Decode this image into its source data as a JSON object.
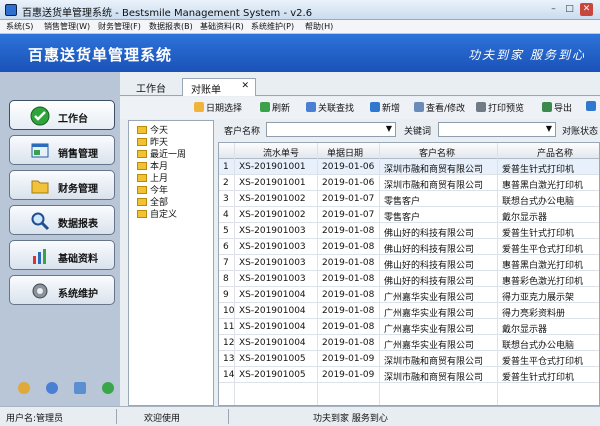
{
  "window": {
    "title": "百惠送货单管理系统 - Bestsmile Management System - v2.6"
  },
  "menu": [
    "系统(S)",
    "销售管理(W)",
    "财务管理(F)",
    "数据报表(B)",
    "基础资料(R)",
    "系统维护(P)",
    "帮助(H)"
  ],
  "banner": {
    "title": "百惠送货单管理系统",
    "slogan": "功夫到家 服务到心"
  },
  "sidebar": {
    "items": [
      {
        "label": "工作台",
        "icon": "check-icon"
      },
      {
        "label": "销售管理",
        "icon": "window-icon"
      },
      {
        "label": "财务管理",
        "icon": "folder-icon"
      },
      {
        "label": "数据报表",
        "icon": "magnifier-icon"
      },
      {
        "label": "基础资料",
        "icon": "chart-icon"
      },
      {
        "label": "系统维护",
        "icon": "gear-icon"
      }
    ]
  },
  "tabs": [
    "工作台",
    "对账单"
  ],
  "toolbar": [
    "日期选择",
    "刷新",
    "关联查找",
    "新增",
    "查看/修改",
    "打印预览",
    "导出"
  ],
  "tree": [
    "今天",
    "昨天",
    "最近一周",
    "本月",
    "上月",
    "今年",
    "全部",
    "自定义"
  ],
  "filter": {
    "customer_label": "客户名称",
    "keyword_label": "关键词",
    "status_label": "对账状态"
  },
  "table": {
    "headers": [
      "流水单号",
      "单据日期",
      "客户名称",
      "产品名称"
    ],
    "rows": [
      [
        "1",
        "XS-201901001",
        "2019-01-06",
        "深圳市融和商贸有限公司",
        "爱普生针式打印机"
      ],
      [
        "2",
        "XS-201901001",
        "2019-01-06",
        "深圳市融和商贸有限公司",
        "惠普黑白激光打印机"
      ],
      [
        "3",
        "XS-201901002",
        "2019-01-07",
        "零售客户",
        "联想台式办公电脑"
      ],
      [
        "4",
        "XS-201901002",
        "2019-01-07",
        "零售客户",
        "戴尔显示器"
      ],
      [
        "5",
        "XS-201901003",
        "2019-01-08",
        "佛山好的科技有限公司",
        "爱普生针式打印机"
      ],
      [
        "6",
        "XS-201901003",
        "2019-01-08",
        "佛山好的科技有限公司",
        "爱普生平仓式打印机"
      ],
      [
        "7",
        "XS-201901003",
        "2019-01-08",
        "佛山好的科技有限公司",
        "惠普黑白激光打印机"
      ],
      [
        "8",
        "XS-201901003",
        "2019-01-08",
        "佛山好的科技有限公司",
        "惠普彩色激光打印机"
      ],
      [
        "9",
        "XS-201901004",
        "2019-01-08",
        "广州嘉华实业有限公司",
        "得力亚克力展示架"
      ],
      [
        "10",
        "XS-201901004",
        "2019-01-08",
        "广州嘉华实业有限公司",
        "得力亮彩资料册"
      ],
      [
        "11",
        "XS-201901004",
        "2019-01-08",
        "广州嘉华实业有限公司",
        "戴尔显示器"
      ],
      [
        "12",
        "XS-201901004",
        "2019-01-08",
        "广州嘉华实业有限公司",
        "联想台式办公电脑"
      ],
      [
        "13",
        "XS-201901005",
        "2019-01-09",
        "深圳市融和商贸有限公司",
        "爱普生平仓式打印机"
      ],
      [
        "14",
        "XS-201901005",
        "2019-01-09",
        "深圳市融和商贸有限公司",
        "爱普生针式打印机"
      ]
    ]
  },
  "status": {
    "user": "用户名:管理员",
    "welcome": "欢迎使用",
    "slogan": "功夫到家 服务到心"
  },
  "colors": {
    "banner": "#1f5fc8",
    "selected_row": "#3d8ee0"
  }
}
